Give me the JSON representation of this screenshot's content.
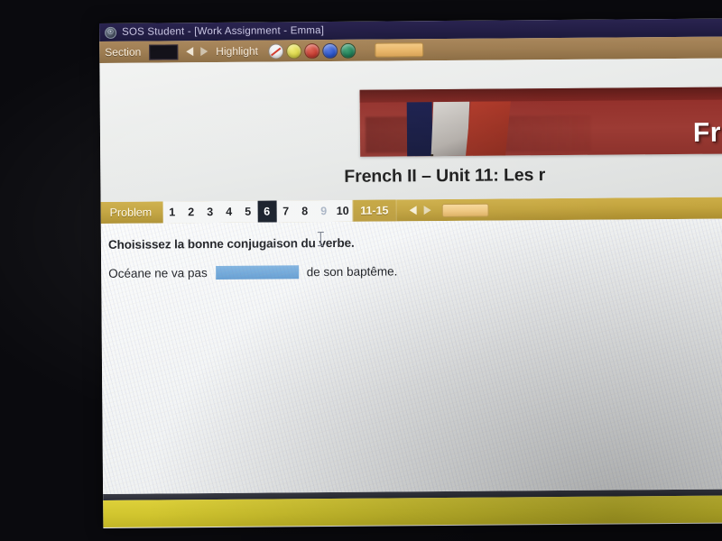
{
  "window": {
    "app_icon": "app-circle-icon",
    "title": "SOS Student - [Work Assignment - Emma]"
  },
  "section_toolbar": {
    "section_label": "Section",
    "section_value": "",
    "prev_icon": "triangle-left-icon",
    "next_icon": "triangle-right-icon",
    "highlight_label": "Highlight",
    "swatches": [
      {
        "name": "no-highlight",
        "color": "#f2f3f4"
      },
      {
        "name": "yellow-highlight",
        "color": "#d9d442"
      },
      {
        "name": "red-highlight",
        "color": "#c4372c"
      },
      {
        "name": "blue-highlight",
        "color": "#2450c8"
      },
      {
        "name": "green-highlight",
        "color": "#1a7a52"
      }
    ],
    "tool_button_label": ""
  },
  "document_header": {
    "banner_word": "Fren",
    "banner_bg": "#93302b",
    "flag_name": "french-flag",
    "title": "French II – Unit 11: Les r"
  },
  "problem_bar": {
    "label": "Problem",
    "numbers": [
      "1",
      "2",
      "3",
      "4",
      "5",
      "6",
      "7",
      "8",
      "9",
      "10"
    ],
    "active": "6",
    "dimmed": "9",
    "range_label": "11-15",
    "prev_icon": "triangle-left-icon",
    "next_icon": "triangle-right-icon",
    "button_label": "",
    "accent": "#c2a33d"
  },
  "question": {
    "prompt": "Choisissez la bonne conjugaison du verbe.",
    "sentence_before": "Océane ne va pas",
    "blank_value": "",
    "blank_color": "#6ba5d8",
    "sentence_after": "de son baptême.",
    "cursor_icon": "text-ibeam-cursor"
  },
  "bottom": {
    "rule_color": "#2f3139",
    "gold_color": "#d2c62f"
  }
}
